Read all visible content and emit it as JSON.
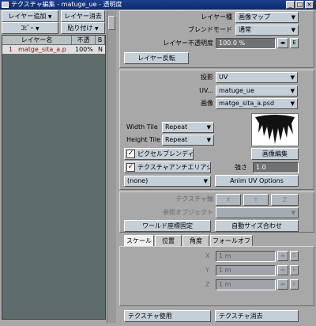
{
  "window": {
    "title": "テクスチャ編集 - matuge_ue - 透明度"
  },
  "titlebar_buttons": [
    "_",
    "□",
    "×"
  ],
  "left": {
    "add_layer": "レイヤー追加",
    "delete_layer": "レイヤー消去",
    "copy": "ｺﾋﾟｰ",
    "paste": "貼り付け",
    "columns": {
      "name": "レイヤー名",
      "opacity": "不透",
      "blend": "B"
    },
    "rows": [
      {
        "num": "1",
        "name": "matge_sita_a.p",
        "opacity": "100%",
        "blend": "N"
      }
    ]
  },
  "top": {
    "layer_type_label": "レイヤー種",
    "layer_type_value": "画像マップ",
    "blend_mode_label": "ブレンドモード",
    "blend_mode_value": "通常",
    "layer_opacity_label": "レイヤー不透明度",
    "layer_opacity_value": "100.0 %",
    "envelope_label": "E",
    "invert_layer": "レイヤー反転"
  },
  "mapping": {
    "projection_label": "投影",
    "projection_value": "UV",
    "uv_label": "UV...",
    "uv_value": "matuge_ue",
    "image_label": "画像",
    "image_value": "matge_sita_a.psd",
    "width_tile_label": "Width Tile",
    "width_tile_value": "Repeat",
    "height_tile_label": "Height Tile",
    "height_tile_value": "Repeat",
    "pixel_blending": "ピクセルブレンディング",
    "texture_aa": "テクスチャアンチエリアシング",
    "edit_image": "画像編集",
    "strength_label": "強さ",
    "strength_value": "1.0",
    "none_value": "(none)",
    "anim_uv": "Anim UV Options",
    "pixel_blending_checked": true,
    "texture_aa_checked": true
  },
  "axis": {
    "texture_axis_label": "テクスチャ軸",
    "x": "X",
    "y": "Y",
    "z": "Z",
    "reference_object_label": "参照オブジェクト",
    "world_coords": "ワールド座標固定",
    "auto_size": "自動サイズ合わせ"
  },
  "tabs": [
    "スケール",
    "位置",
    "角度",
    "フォールオフ"
  ],
  "scale": {
    "rows": [
      {
        "axis": "X",
        "value": "1 m"
      },
      {
        "axis": "Y",
        "value": "1 m"
      },
      {
        "axis": "Z",
        "value": "1 m"
      }
    ]
  },
  "bottom": {
    "use_texture": "テクスチャ使用",
    "delete_texture": "テクスチャ消去"
  },
  "glyphs": {
    "dropdown_arrow": "▼",
    "envelope_arrows": "◂▸",
    "check": "✓"
  },
  "colors": {
    "titlebar": "#1c3f8c",
    "window_bg": "#a8a8a8",
    "button": "#c4cfd8",
    "list_bg": "#5f6c6c"
  }
}
